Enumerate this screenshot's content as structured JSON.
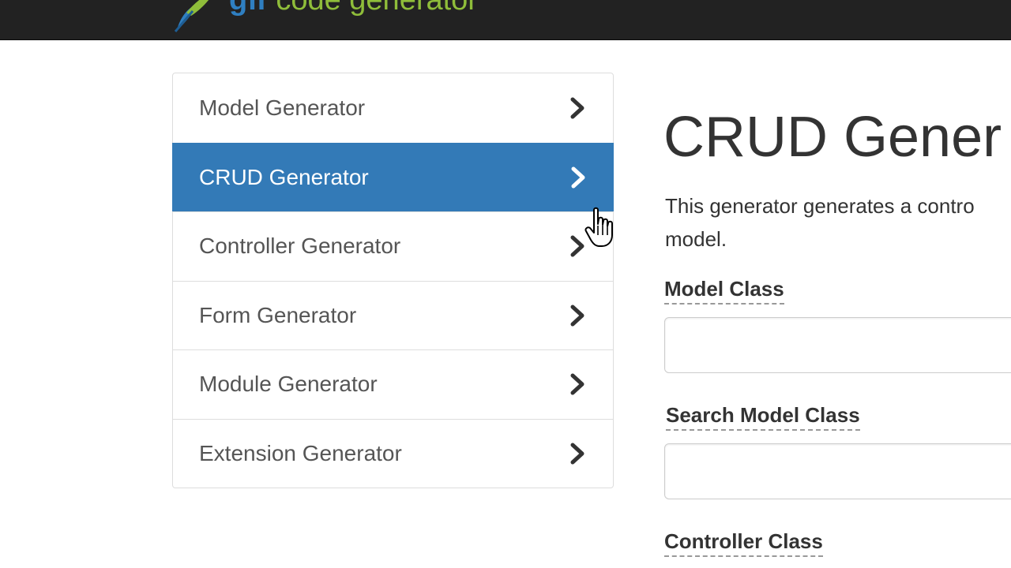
{
  "header": {
    "brand_primary": "gii",
    "brand_secondary": "code generator",
    "logo_icon": "quill-icon",
    "background": "#222222",
    "primary_color": "#2f7fc1",
    "secondary_color": "#8fbd3a"
  },
  "sidebar": {
    "items": [
      {
        "label": "Model Generator",
        "active": false
      },
      {
        "label": "CRUD Generator",
        "active": true
      },
      {
        "label": "Controller Generator",
        "active": false
      },
      {
        "label": "Form Generator",
        "active": false
      },
      {
        "label": "Module Generator",
        "active": false
      },
      {
        "label": "Extension Generator",
        "active": false
      }
    ],
    "item_icon": "chevron-right-icon",
    "active_color": "#337ab7"
  },
  "main": {
    "title": "CRUD Gener",
    "description": "This generator generates a contro model.",
    "fields": [
      {
        "label": "Model Class",
        "value": "",
        "placeholder": ""
      },
      {
        "label": "Search Model Class",
        "value": "",
        "placeholder": ""
      },
      {
        "label": "Controller Class"
      }
    ]
  },
  "cursor": {
    "icon": "hand-pointer-icon"
  }
}
